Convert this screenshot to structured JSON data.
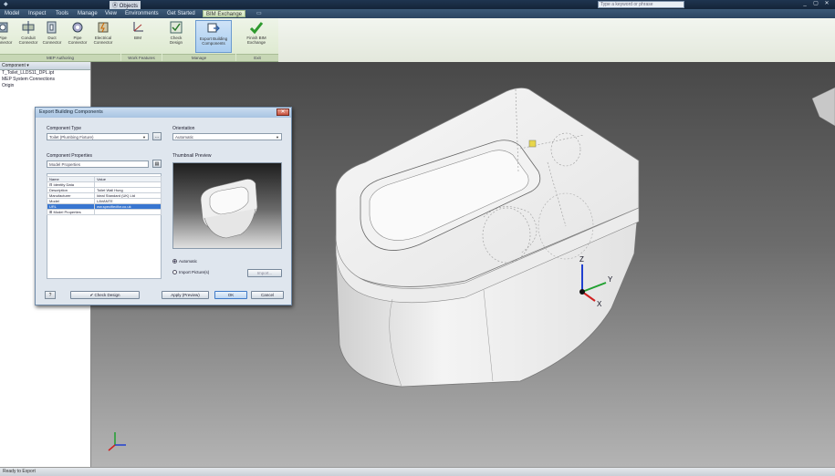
{
  "titlebar": {
    "project": "Ⓐ Objects",
    "search_placeholder": "Type a keyword or phrase"
  },
  "menu_tabs": [
    "Model",
    "Inspect",
    "Tools",
    "Manage",
    "View",
    "Environments",
    "Get Started",
    "BIM Exchange"
  ],
  "active_menu_tab": "BIM Exchange",
  "ribbon": {
    "tools": [
      {
        "label": "Pipe Connector",
        "icon": "pipe-connector-icon"
      },
      {
        "label": "Conduit Connector",
        "icon": "conduit-connector-icon"
      },
      {
        "label": "Duct Connector",
        "icon": "duct-connector-icon"
      },
      {
        "label": "Pipe Connector",
        "icon": "pipe-connector-icon"
      },
      {
        "label": "Electrical Connector",
        "icon": "electrical-connector-icon"
      },
      {
        "label": "BIM",
        "icon": "bim-axes-icon"
      },
      {
        "label": "Check Design",
        "icon": "check-design-icon"
      },
      {
        "label": "Export Building Components",
        "icon": "export-components-icon"
      },
      {
        "label": "Finish BIM Exchange",
        "icon": "finish-checkmark-icon"
      }
    ],
    "panels": [
      "MEP Authoring",
      "Work Features",
      "Manage",
      "Exit"
    ]
  },
  "browser": {
    "header": "Component ▾",
    "items": [
      "T_Toilet_LLDS11_DPL.ipt",
      "MEP System Connections",
      "Origin"
    ]
  },
  "dialog": {
    "title": "Export Building Components",
    "component_type_label": "Component Type",
    "component_type_value": "Toilet (Plumbing Fixture)",
    "orientation_label": "Orientation",
    "orientation_value": "Automatic",
    "component_properties_label": "Component Properties",
    "model_properties_label": "Model Properties",
    "table_headers": [
      "Name",
      "Value"
    ],
    "table_rows": [
      {
        "name": "⊟ Identity Data",
        "value": ""
      },
      {
        "name": "Description",
        "value": "Toilet Wall Hung"
      },
      {
        "name": "Manufacturer",
        "value": "Ideal Standard (UK) Ltd"
      },
      {
        "name": "Model",
        "value": "LAVANTE"
      },
      {
        "name": "URL",
        "value": "ww.specifiedfor.co.uk"
      },
      {
        "name": "⊞ Model Properties",
        "value": ""
      }
    ],
    "thumbnail_label": "Thumbnail Preview",
    "radio_automatic": "Automatic",
    "radio_import": "Import Picture(s)",
    "import_button": "Import...",
    "check_design_button": "✔ Check Design",
    "apply_button": "Apply (Preview)",
    "ok_button": "OK",
    "cancel_button": "Cancel"
  },
  "statusbar": {
    "text": "Ready to Export"
  },
  "colors": {
    "ribbon_green": "#dbe8cc",
    "selected_blue": "#a9cdf0",
    "highlight_row": "#3876d0",
    "axis_x": "#d02020",
    "axis_y": "#20a030",
    "axis_z": "#2040d0"
  }
}
